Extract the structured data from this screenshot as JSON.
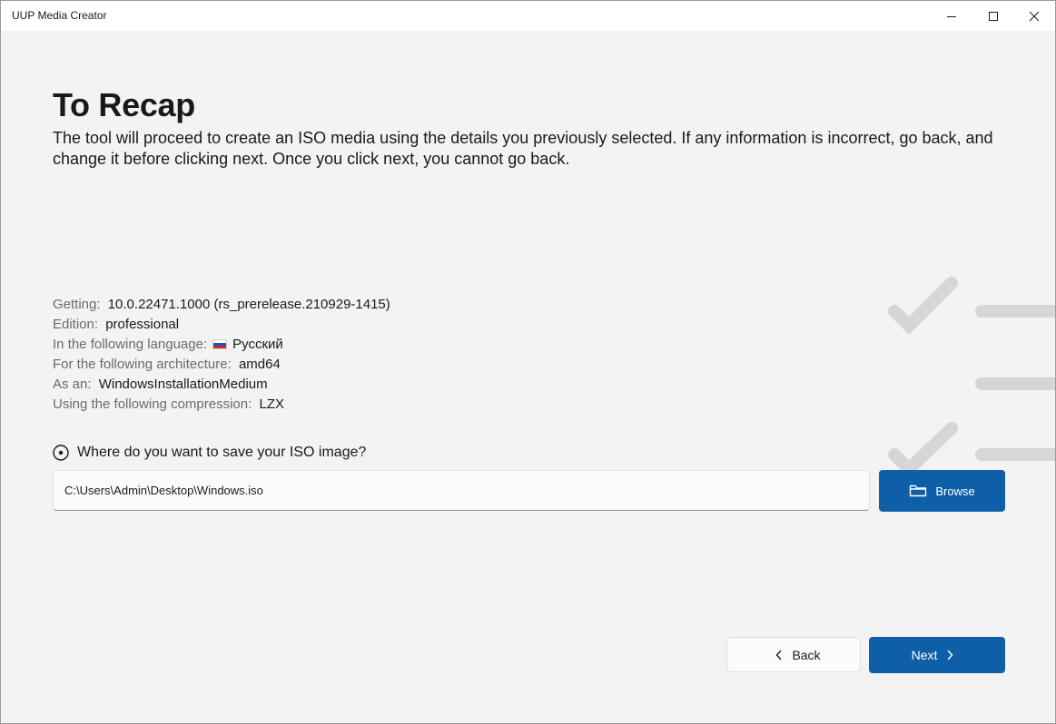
{
  "window": {
    "title": "UUP Media Creator"
  },
  "page": {
    "heading": "To Recap",
    "subtitle": "The tool will proceed to create an ISO media using the details you previously selected. If any information is incorrect, go back, and change it before clicking next. Once you click next, you cannot go back."
  },
  "details": [
    {
      "label": "Getting:",
      "value": "10.0.22471.1000 (rs_prerelease.210929-1415)"
    },
    {
      "label": "Edition:",
      "value": "professional"
    },
    {
      "label": "In the following language:",
      "value": "Русский",
      "icon": "russia-flag-icon"
    },
    {
      "label": "For the following architecture:",
      "value": "amd64"
    },
    {
      "label": "As an:",
      "value": "WindowsInstallationMedium"
    },
    {
      "label": "Using the following compression:",
      "value": "LZX"
    }
  ],
  "save": {
    "question": "Where do you want to save your ISO image?",
    "path": "C:\\Users\\Admin\\Desktop\\Windows.iso",
    "browse_label": "Browse"
  },
  "nav": {
    "back_label": "Back",
    "next_label": "Next"
  },
  "colors": {
    "accent": "#0f5ea8",
    "background": "#f3f3f3",
    "decoration": "#d6d6d6"
  }
}
